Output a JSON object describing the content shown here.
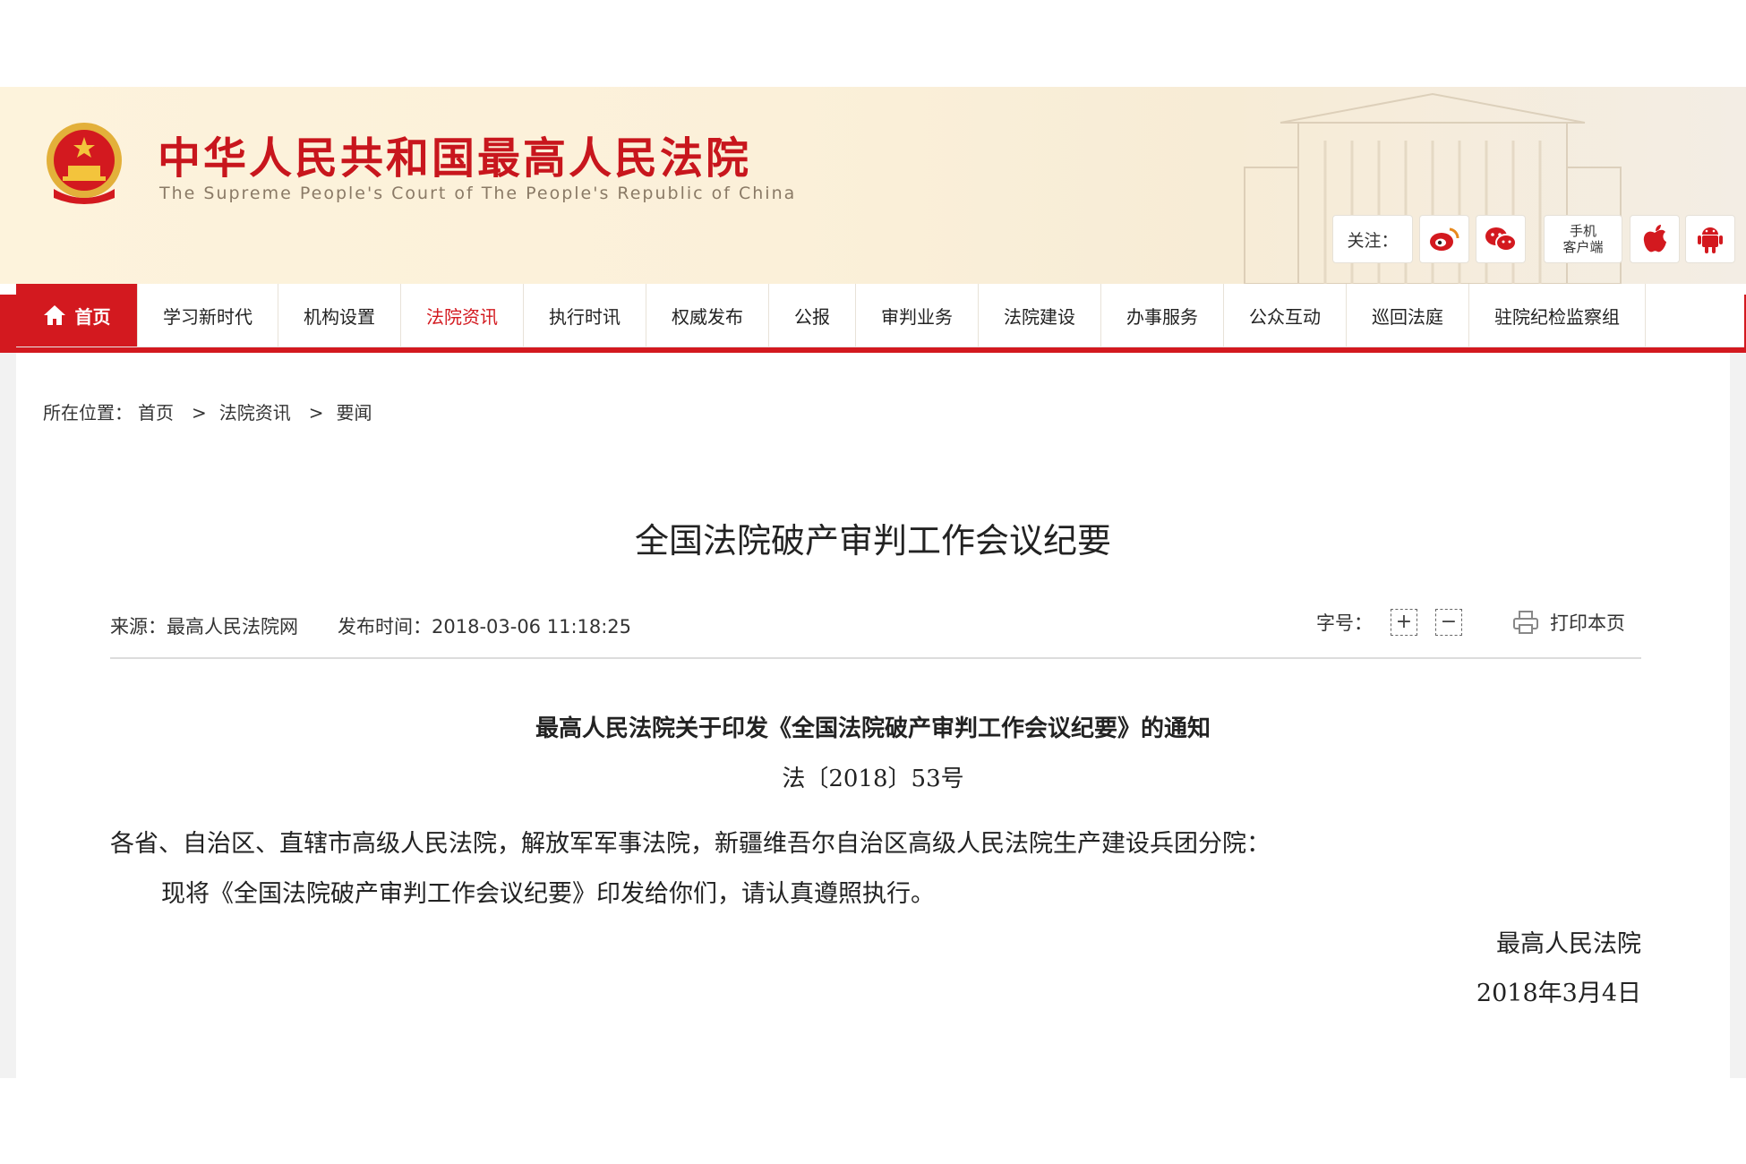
{
  "header": {
    "title": "中华人民共和国最高人民法院",
    "subtitle": "The Supreme People's Court of The People's Republic of China",
    "follow_label": "关注：",
    "mobile_client_line1": "手机",
    "mobile_client_line2": "客户端",
    "social_icons": [
      "weibo-icon",
      "wechat-icon",
      "apple-icon",
      "android-icon"
    ]
  },
  "nav": {
    "home": "首页",
    "items": [
      "学习新时代",
      "机构设置",
      "法院资讯",
      "执行时讯",
      "权威发布",
      "公报",
      "审判业务",
      "法院建设",
      "办事服务",
      "公众互动",
      "巡回法庭",
      "驻院纪检监察组"
    ],
    "active_item": "法院资讯"
  },
  "breadcrumb": {
    "label": "所在位置：",
    "items": [
      "首页",
      "法院资讯",
      "要闻"
    ],
    "separator": ">"
  },
  "article": {
    "title": "全国法院破产审判工作会议纪要",
    "source": "来源：最高人民法院网",
    "published": "发布时间：2018-03-06 11:18:25",
    "font_size_label": "字号：",
    "font_plus": "+",
    "font_minus": "−",
    "print_label": "打印本页"
  },
  "notice": {
    "title": "最高人民法院关于印发《全国法院破产审判工作会议纪要》的通知",
    "doc_number": "法〔2018〕53号",
    "addressee": "各省、自治区、直辖市高级人民法院，解放军军事法院，新疆维吾尔自治区高级人民法院生产建设兵团分院：",
    "body": "现将《全国法院破产审判工作会议纪要》印发给你们，请认真遵照执行。",
    "signature_org": "最高人民法院",
    "signature_date": "2018年3月4日"
  },
  "colors": {
    "brand_red": "#d3191f",
    "title_red": "#c8161d",
    "banner_bg": "#fbf0d9"
  }
}
